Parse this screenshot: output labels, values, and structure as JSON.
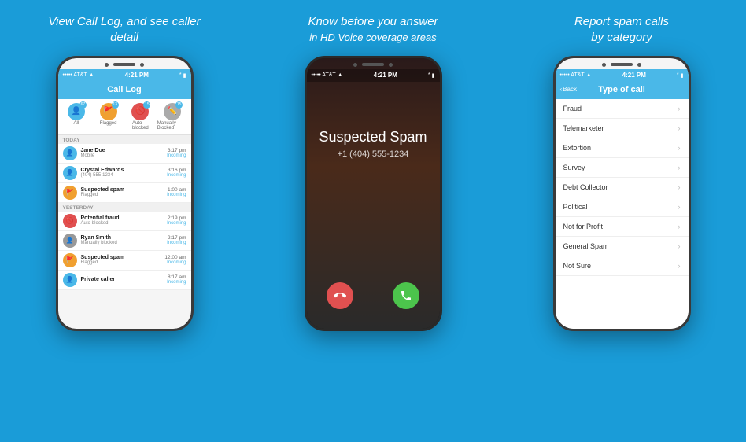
{
  "columns": [
    {
      "id": "col1",
      "caption": "View Call Log,\nand see caller detail",
      "caption_style": "two-line"
    },
    {
      "id": "col2",
      "caption_main": "Know before you answer",
      "caption_sub": "in HD Voice coverage areas"
    },
    {
      "id": "col3",
      "caption": "Report spam calls\nby category"
    }
  ],
  "phone1": {
    "status": {
      "carrier": "••••• AT&T",
      "time": "4:21 PM",
      "battery": "🔋"
    },
    "header_title": "Call Log",
    "tabs": [
      {
        "label": "All",
        "badge": "67",
        "color": "blue",
        "icon": "👤"
      },
      {
        "label": "Flagged",
        "badge": "13",
        "color": "orange",
        "icon": "🚩"
      },
      {
        "label": "Auto-blocked",
        "badge": "15",
        "color": "red",
        "icon": "🚫"
      },
      {
        "label": "Manually Blocked",
        "badge": "15",
        "color": "gray",
        "icon": "✏️"
      }
    ],
    "sections": [
      {
        "label": "TODAY",
        "items": [
          {
            "name": "Jane Doe",
            "sub": "Mobile",
            "time": "3:17 pm",
            "dir": "Incoming",
            "avatar": "blue"
          },
          {
            "name": "Crystal Edwards",
            "sub": "(404) 555-1234",
            "time": "3:16 pm",
            "dir": "Incoming",
            "avatar": "blue"
          },
          {
            "name": "Suspected spam",
            "sub": "Flagged",
            "time": "1:00 am",
            "dir": "Incoming",
            "avatar": "orange"
          }
        ]
      },
      {
        "label": "YESTERDAY",
        "items": [
          {
            "name": "Potential fraud",
            "sub": "Auto-blocked",
            "time": "2:19 pm",
            "dir": "Incoming",
            "avatar": "red"
          },
          {
            "name": "Ryan Smith",
            "sub": "Manually blocked",
            "time": "2:17 pm",
            "dir": "Incoming",
            "avatar": "gray"
          },
          {
            "name": "Suspected spam",
            "sub": "Flagged",
            "time": "12:00 am",
            "dir": "Incoming",
            "avatar": "orange"
          },
          {
            "name": "Private caller",
            "sub": "",
            "time": "8:17 am",
            "dir": "Incoming",
            "avatar": "blue"
          }
        ]
      }
    ]
  },
  "phone2": {
    "status": {
      "carrier": "••••• AT&T",
      "time": "4:21 PM"
    },
    "caller_name": "Suspected Spam",
    "caller_number": "+1 (404) 555-1234",
    "buttons": {
      "decline_icon": "📞",
      "accept_icon": "📞"
    }
  },
  "phone3": {
    "status": {
      "carrier": "••••• AT&T",
      "time": "4:21 PM"
    },
    "back_label": "Back",
    "header_title": "Type of call",
    "types": [
      "Fraud",
      "Telemarketer",
      "Extortion",
      "Survey",
      "Debt Collector",
      "Political",
      "Not for Profit",
      "General Spam",
      "Not Sure"
    ]
  }
}
